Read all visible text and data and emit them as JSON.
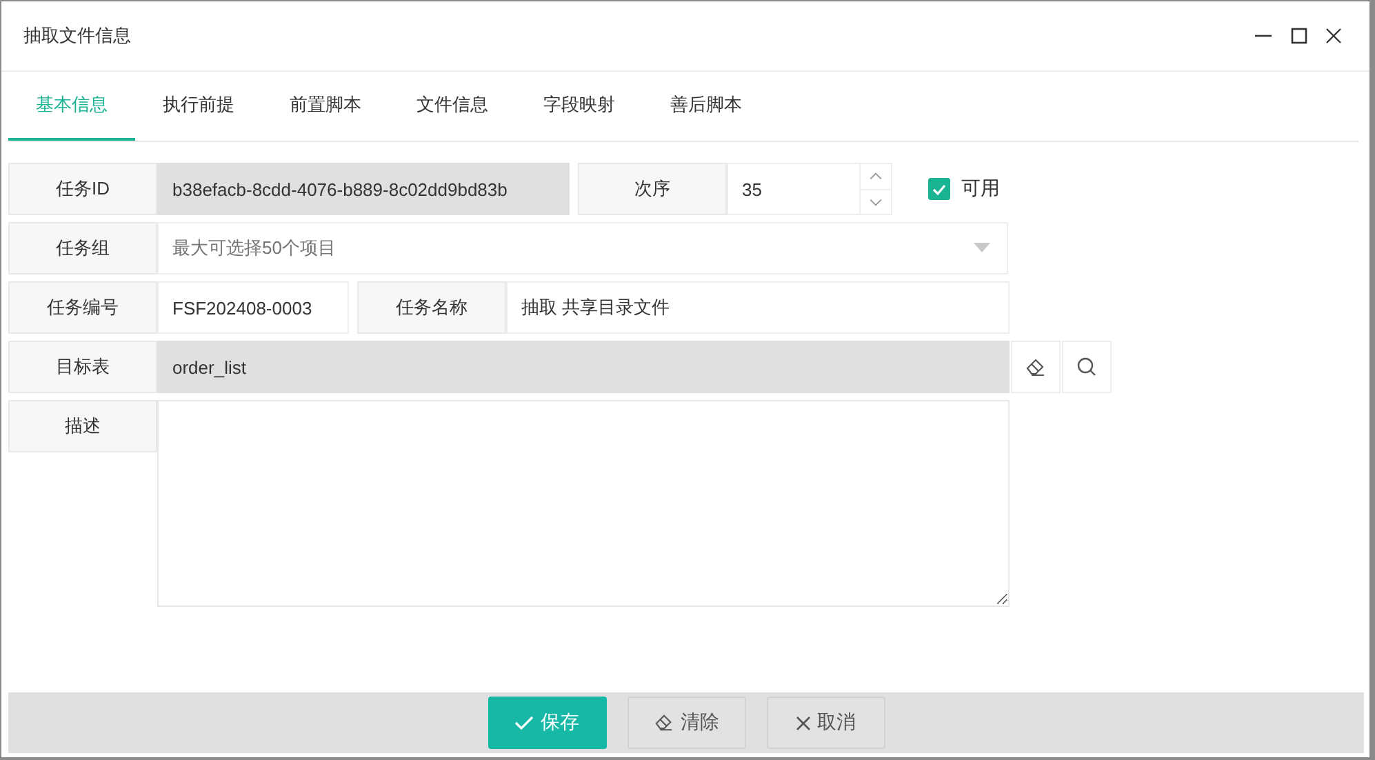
{
  "window": {
    "title": "抽取文件信息"
  },
  "tabs": [
    {
      "label": "基本信息",
      "selected": true
    },
    {
      "label": "执行前提",
      "selected": false
    },
    {
      "label": "前置脚本",
      "selected": false
    },
    {
      "label": "文件信息",
      "selected": false
    },
    {
      "label": "字段映射",
      "selected": false
    },
    {
      "label": "善后脚本",
      "selected": false
    }
  ],
  "form": {
    "task_id": {
      "label": "任务ID",
      "value": "b38efacb-8cdd-4076-b889-8c02dd9bd83b",
      "disabled": true
    },
    "order": {
      "label": "次序",
      "value": "35"
    },
    "enabled": {
      "label": "可用",
      "checked": true
    },
    "task_group": {
      "label": "任务组",
      "placeholder": "最大可选择50个项目"
    },
    "task_code": {
      "label": "任务编号",
      "value": "FSF202408-0003"
    },
    "task_name": {
      "label": "任务名称",
      "value": "抽取 共享目录文件"
    },
    "target_table": {
      "label": "目标表",
      "value": "order_list",
      "disabled": true
    },
    "description": {
      "label": "描述"
    }
  },
  "buttons": [
    {
      "kind": "save",
      "label": "保存"
    },
    {
      "kind": "clear",
      "label": "清除"
    },
    {
      "kind": "cancel",
      "label": "取消"
    }
  ]
}
